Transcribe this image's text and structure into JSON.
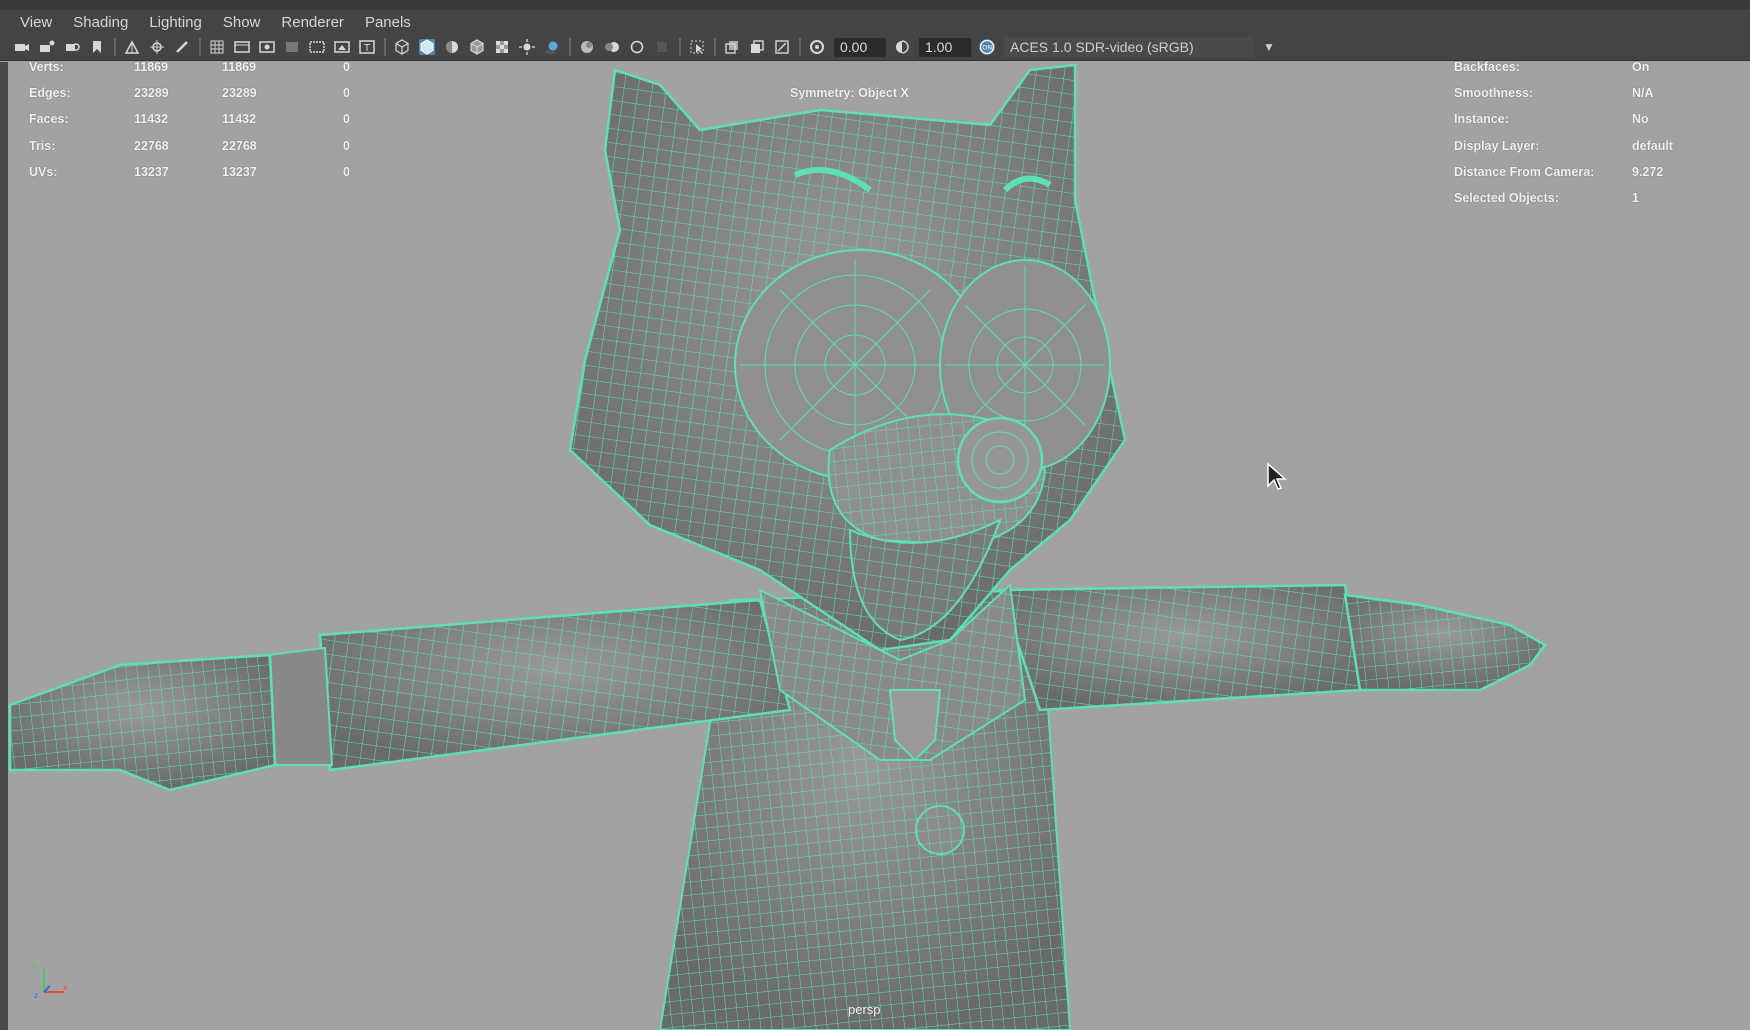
{
  "menu": [
    "View",
    "Shading",
    "Lighting",
    "Show",
    "Renderer",
    "Panels"
  ],
  "toolbar": {
    "exposure": "0.00",
    "gamma": "1.00",
    "colorspace": "ACES 1.0 SDR-video (sRGB)"
  },
  "hud_left": {
    "rows": [
      {
        "label": "Verts:",
        "a": "11869",
        "b": "11869",
        "c": "0"
      },
      {
        "label": "Edges:",
        "a": "23289",
        "b": "23289",
        "c": "0"
      },
      {
        "label": "Faces:",
        "a": "11432",
        "b": "11432",
        "c": "0"
      },
      {
        "label": "Tris:",
        "a": "22768",
        "b": "22768",
        "c": "0"
      },
      {
        "label": "UVs:",
        "a": "13237",
        "b": "13237",
        "c": "0"
      }
    ]
  },
  "hud_right": {
    "rows": [
      {
        "label": "Backfaces:",
        "value": "On"
      },
      {
        "label": "Smoothness:",
        "value": "N/A"
      },
      {
        "label": "Instance:",
        "value": "No"
      },
      {
        "label": "Display Layer:",
        "value": "default"
      },
      {
        "label": "Distance From Camera:",
        "value": "9.272"
      },
      {
        "label": "Selected Objects:",
        "value": "1"
      }
    ]
  },
  "symmetry": "Symmetry: Object X",
  "camera": "persp",
  "colors": {
    "wire": "#5ee0b0",
    "viewport": "#a2a2a2",
    "ui": "#444444"
  }
}
